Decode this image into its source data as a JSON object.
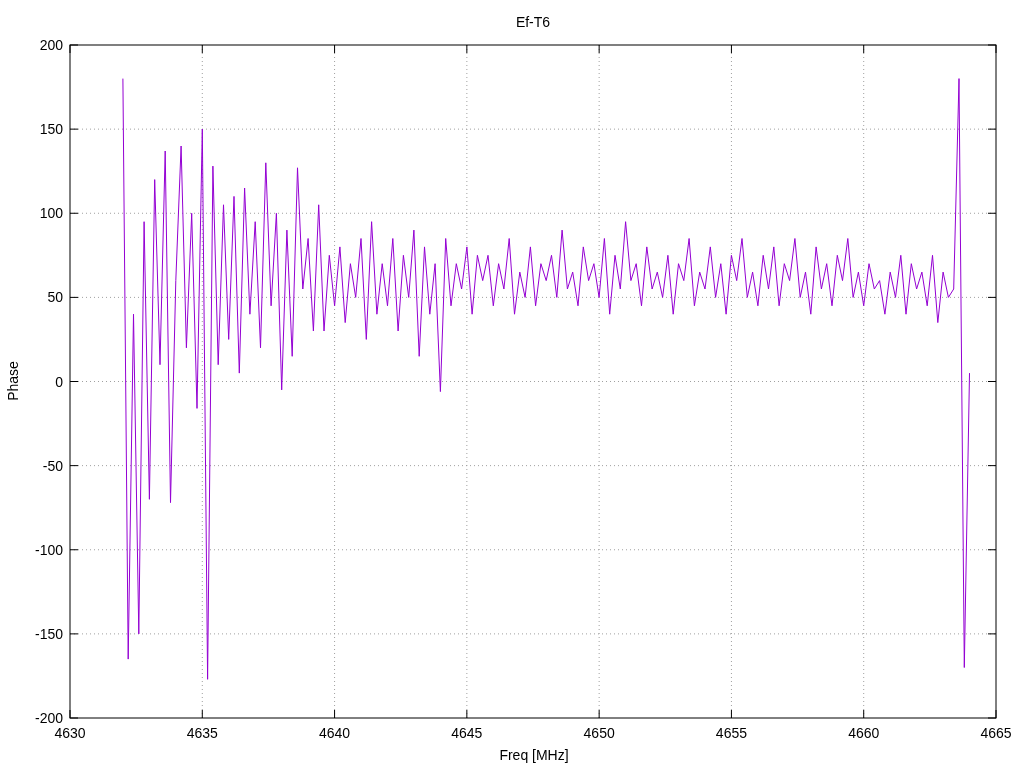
{
  "chart_data": {
    "type": "line",
    "title": "Ef-T6",
    "xlabel": "Freq [MHz]",
    "ylabel": "Phase",
    "grid": true,
    "xlim": [
      4630,
      4665
    ],
    "ylim": [
      -200,
      200
    ],
    "xticks": [
      4630,
      4635,
      4640,
      4645,
      4650,
      4655,
      4660,
      4665
    ],
    "yticks": [
      -200,
      -150,
      -100,
      -50,
      0,
      50,
      100,
      150,
      200
    ],
    "x": [
      4632,
      4632.2,
      4632.4,
      4632.6,
      4632.8,
      4633,
      4633.2,
      4633.4,
      4633.6,
      4633.8,
      4634,
      4634.2,
      4634.4,
      4634.6,
      4634.8,
      4635,
      4635.2,
      4635.4,
      4635.6,
      4635.8,
      4636,
      4636.2,
      4636.4,
      4636.6,
      4636.8,
      4637,
      4637.2,
      4637.4,
      4637.6,
      4637.8,
      4638,
      4638.2,
      4638.4,
      4638.6,
      4638.8,
      4639,
      4639.2,
      4639.4,
      4639.6,
      4639.8,
      4640,
      4640.2,
      4640.4,
      4640.6,
      4640.8,
      4641,
      4641.2,
      4641.4,
      4641.6,
      4641.8,
      4642,
      4642.2,
      4642.4,
      4642.6,
      4642.8,
      4643,
      4643.2,
      4643.4,
      4643.6,
      4643.8,
      4644,
      4644.2,
      4644.4,
      4644.6,
      4644.8,
      4645,
      4645.2,
      4645.4,
      4645.6,
      4645.8,
      4646,
      4646.2,
      4646.4,
      4646.6,
      4646.8,
      4647,
      4647.2,
      4647.4,
      4647.6,
      4647.8,
      4648,
      4648.2,
      4648.4,
      4648.6,
      4648.8,
      4649,
      4649.2,
      4649.4,
      4649.6,
      4649.8,
      4650,
      4650.2,
      4650.4,
      4650.6,
      4650.8,
      4651,
      4651.2,
      4651.4,
      4651.6,
      4651.8,
      4652,
      4652.2,
      4652.4,
      4652.6,
      4652.8,
      4653,
      4653.2,
      4653.4,
      4653.6,
      4653.8,
      4654,
      4654.2,
      4654.4,
      4654.6,
      4654.8,
      4655,
      4655.2,
      4655.4,
      4655.6,
      4655.8,
      4656,
      4656.2,
      4656.4,
      4656.6,
      4656.8,
      4657,
      4657.2,
      4657.4,
      4657.6,
      4657.8,
      4658,
      4658.2,
      4658.4,
      4658.6,
      4658.8,
      4659,
      4659.2,
      4659.4,
      4659.6,
      4659.8,
      4660,
      4660.2,
      4660.4,
      4660.6,
      4660.8,
      4661,
      4661.2,
      4661.4,
      4661.6,
      4661.8,
      4662,
      4662.2,
      4662.4,
      4662.6,
      4662.8,
      4663,
      4663.2,
      4663.4,
      4663.6,
      4663.8,
      4664
    ],
    "series": [
      {
        "color": "#9400d3",
        "values": [
          180,
          -165,
          40,
          -150,
          95,
          -70,
          120,
          10,
          137,
          -72,
          60,
          140,
          20,
          100,
          -16,
          150,
          -177,
          128,
          10,
          105,
          25,
          110,
          5,
          115,
          40,
          95,
          20,
          130,
          45,
          100,
          -5,
          90,
          15,
          127,
          55,
          85,
          30,
          105,
          30,
          75,
          45,
          80,
          35,
          70,
          50,
          85,
          25,
          95,
          40,
          70,
          45,
          85,
          30,
          75,
          50,
          90,
          15,
          80,
          40,
          70,
          -6,
          85,
          45,
          70,
          55,
          80,
          40,
          75,
          60,
          75,
          45,
          70,
          55,
          85,
          40,
          65,
          50,
          80,
          45,
          70,
          60,
          75,
          50,
          90,
          55,
          65,
          45,
          80,
          60,
          70,
          50,
          85,
          40,
          75,
          55,
          95,
          60,
          70,
          45,
          80,
          55,
          65,
          50,
          75,
          40,
          70,
          60,
          85,
          45,
          65,
          55,
          80,
          50,
          70,
          40,
          75,
          60,
          85,
          50,
          65,
          45,
          75,
          55,
          80,
          45,
          70,
          60,
          85,
          50,
          65,
          40,
          80,
          55,
          70,
          45,
          75,
          60,
          85,
          50,
          65,
          45,
          70,
          55,
          60,
          40,
          65,
          50,
          75,
          40,
          70,
          55,
          65,
          45,
          75,
          35,
          65,
          50,
          55,
          180,
          -170,
          5
        ]
      }
    ]
  }
}
